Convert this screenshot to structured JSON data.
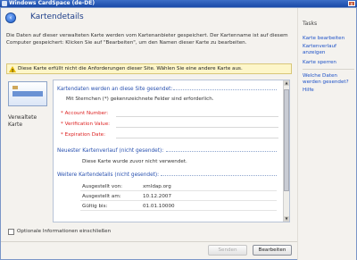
{
  "titlebar": {
    "title": "Windows CardSpace (de-DE)",
    "close_label": "x"
  },
  "header": {
    "title": "Kartendetails",
    "back_label": "‹"
  },
  "description": "Die Daten auf dieser verwalteten Karte werden vom Kartenanbieter gespeichert. Der Kartenname ist auf diesem Computer gespeichert: Klicken Sie auf \"Bearbeiten\", um den Namen dieser Karte zu bearbeiten.",
  "warning": {
    "text": "Diese Karte erfüllt nicht die Anforderungen dieser Site. Wählen Sie eine andere Karte aus.",
    "icon": "warning-icon"
  },
  "card": {
    "caption_line1": "Verwaltete",
    "caption_line2": "Karte"
  },
  "sections": {
    "sent": {
      "title": "Kartendaten werden an diese Site gesendet:",
      "note": "Mit Sternchen (*) gekennzeichnete Felder sind erforderlich.",
      "fields": [
        "* Account Number:",
        "* Verification Value:",
        "* Expiration Date:"
      ]
    },
    "history": {
      "title": "Neuester Kartenverlauf (nicht gesendet):",
      "text": "Diese Karte wurde zuvor nicht verwendet."
    },
    "details": {
      "title": "Weitere Kartendetails (nicht gesendet):",
      "rows": [
        {
          "label": "Ausgestellt von:",
          "value": "xmldap.org"
        },
        {
          "label": "Ausgestellt am:",
          "value": "10.12.2007"
        },
        {
          "label": "Gültig bis:",
          "value": "01.01.10000"
        }
      ]
    }
  },
  "options": {
    "checkbox_label": "Optionale Informationen einschließen",
    "checked": false
  },
  "buttons": {
    "send": "Senden",
    "edit": "Bearbeiten"
  },
  "tasks": {
    "title": "Tasks",
    "links": [
      "Karte bearbeiten",
      "Kartenverlauf anzeigen",
      "Karte sperren",
      "Welche Daten werden gesendet?",
      "Hilfe"
    ]
  },
  "colors": {
    "accent": "#1e52c8",
    "title_blue": "#1f3f8a",
    "required_red": "#dd2222",
    "warning_bg": "#fdf6c9"
  }
}
